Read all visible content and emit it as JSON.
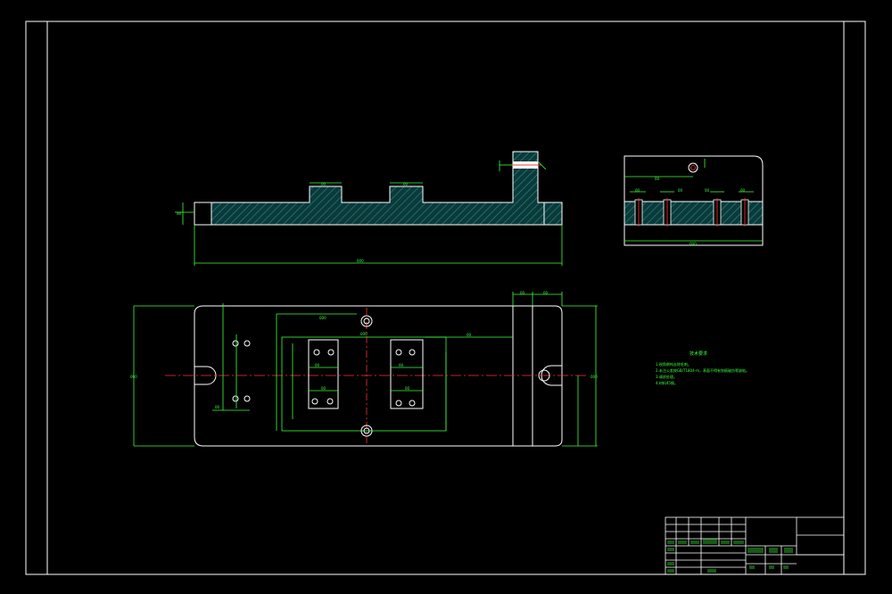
{
  "colors": {
    "background": "#000000",
    "outline": "#ffffff",
    "dimension": "#3cff3c",
    "hatch": "#2f8a8a",
    "centerline": "#ff3333",
    "hatch_fill": "#0b3a3a"
  },
  "icons": {
    "hatch_pattern": "diagonal-hatch",
    "hole_symbol": "circle-with-center"
  },
  "title_block": {
    "labels": [
      "",
      "",
      "",
      "",
      "",
      ""
    ]
  }
}
